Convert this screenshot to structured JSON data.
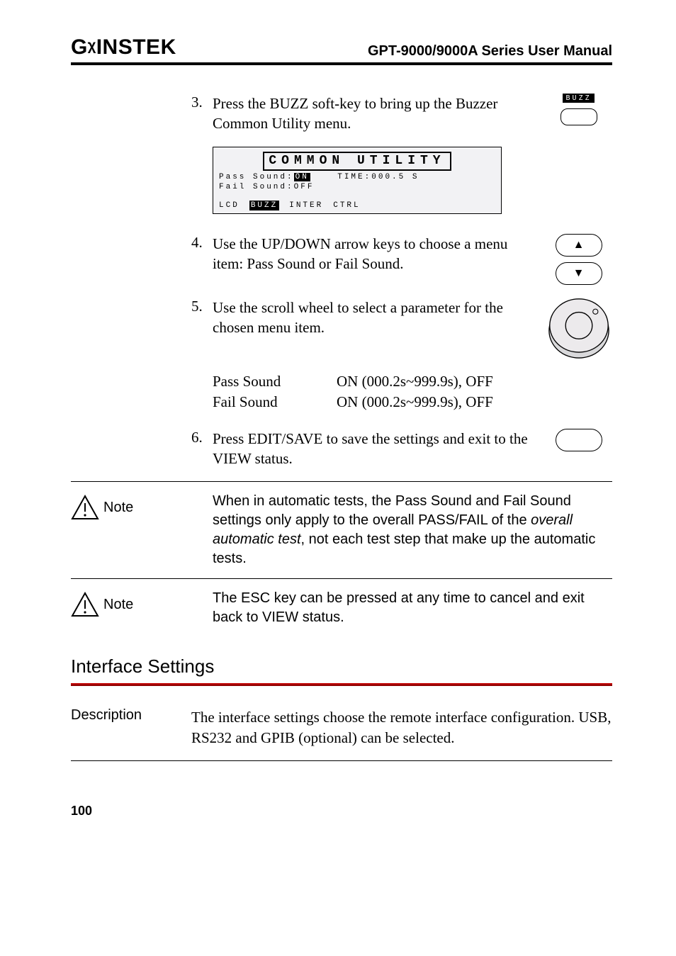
{
  "header": {
    "logo_pre": "G",
    "logo_u": "W",
    "logo_post": "INSTEK",
    "manual_title": "GPT-9000/9000A Series User Manual"
  },
  "steps": {
    "s3_num": "3.",
    "s3_text": "Press the BUZZ soft-key to bring up the Buzzer Common Utility menu.",
    "s3_softkey_label": "BUZZ",
    "s4_num": "4.",
    "s4_text": "Use the UP/DOWN arrow keys to choose a menu item: Pass Sound or Fail Sound.",
    "s5_num": "5.",
    "s5_text": "Use the scroll wheel to select a parameter for the chosen menu item.",
    "s6_num": "6.",
    "s6_text": "Press EDIT/SAVE to save the settings and exit to the VIEW status."
  },
  "lcd": {
    "title": "COMMON UTILITY",
    "row1_pre": "Pass Sound:",
    "row1_val": "ON",
    "row1_time": "TIME:000.5 S",
    "row2": "Fail Sound:OFF",
    "k1": "LCD",
    "k2": "BUZZ",
    "k3": "INTER",
    "k4": "CTRL"
  },
  "params": {
    "pass_label": "Pass Sound",
    "pass_val": "ON (000.2s~999.9s), OFF",
    "fail_label": "Fail Sound",
    "fail_val": "ON (000.2s~999.9s), OFF"
  },
  "notes": {
    "note_label": "Note",
    "n1_pre": "When in automatic tests, the Pass Sound and Fail Sound settings only apply to the overall PASS/FAIL of the ",
    "n1_italic": "overall automatic test",
    "n1_post": ", not each test step that make up the automatic tests.",
    "n2": "The ESC key can be pressed at any time to cancel and exit back to VIEW status."
  },
  "interface": {
    "heading": "Interface Settings",
    "desc_label": "Description",
    "desc_text": "The interface settings choose the remote interface configuration. USB, RS232 and GPIB (optional) can be selected."
  },
  "page_number": "100"
}
